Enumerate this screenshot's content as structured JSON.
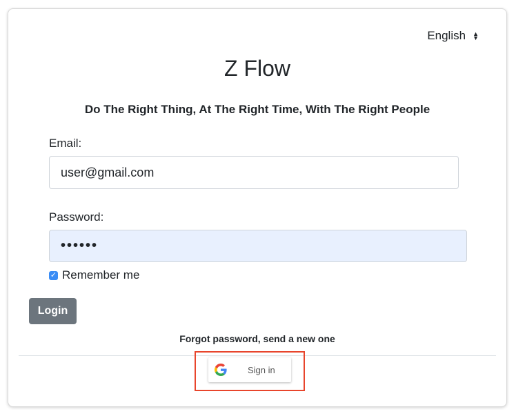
{
  "language": {
    "selected": "English",
    "icon": "sort-arrows-icon"
  },
  "app": {
    "title": "Z Flow",
    "tagline": "Do The Right Thing, At The Right Time, With The Right People"
  },
  "form": {
    "email_label": "Email:",
    "email_value": "user@gmail.com",
    "password_label": "Password:",
    "password_value": "••••••",
    "remember_label": "Remember me",
    "remember_checked": true,
    "login_label": "Login",
    "forgot_label": "Forgot password, send a new one"
  },
  "google": {
    "label": "Sign in",
    "icon": "google-logo-icon"
  },
  "colors": {
    "login_button": "#6c757d",
    "autofill_bg": "#e8f0fe",
    "checkbox": "#3b8df5",
    "highlight": "#e8452c"
  }
}
